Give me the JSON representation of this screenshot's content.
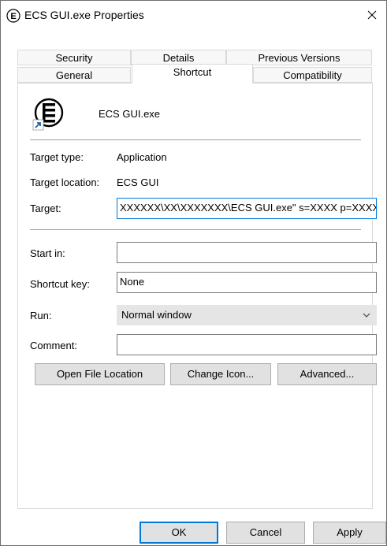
{
  "window": {
    "title": "ECS GUI.exe Properties",
    "close_glyph": "✕"
  },
  "tabs": {
    "row1": [
      {
        "label": "Security"
      },
      {
        "label": "Details"
      },
      {
        "label": "Previous Versions"
      }
    ],
    "row2": [
      {
        "label": "General"
      },
      {
        "label": "Shortcut",
        "active": true
      },
      {
        "label": "Compatibility"
      }
    ]
  },
  "shortcut": {
    "file_name": "ECS GUI.exe",
    "icon_letter": "E",
    "fields": {
      "target_type_label": "Target type:",
      "target_type_value": "Application",
      "target_location_label": "Target location:",
      "target_location_value": "ECS GUI",
      "target_label": "Target:",
      "target_value": "XXXXXX\\XX\\XXXXXXX\\ECS GUI.exe\" s=XXXX p=XXXX",
      "start_in_label": "Start in:",
      "start_in_value": "",
      "shortcut_key_label": "Shortcut key:",
      "shortcut_key_value": "None",
      "run_label": "Run:",
      "run_value": "Normal window",
      "comment_label": "Comment:",
      "comment_value": ""
    },
    "buttons": {
      "open_file_location": "Open File Location",
      "change_icon": "Change Icon...",
      "advanced": "Advanced..."
    }
  },
  "footer": {
    "ok": "OK",
    "cancel": "Cancel",
    "apply": "Apply"
  },
  "colors": {
    "accent": "#0078d7",
    "button_bg": "#e1e1e1",
    "select_bg": "#e5e5e5"
  }
}
